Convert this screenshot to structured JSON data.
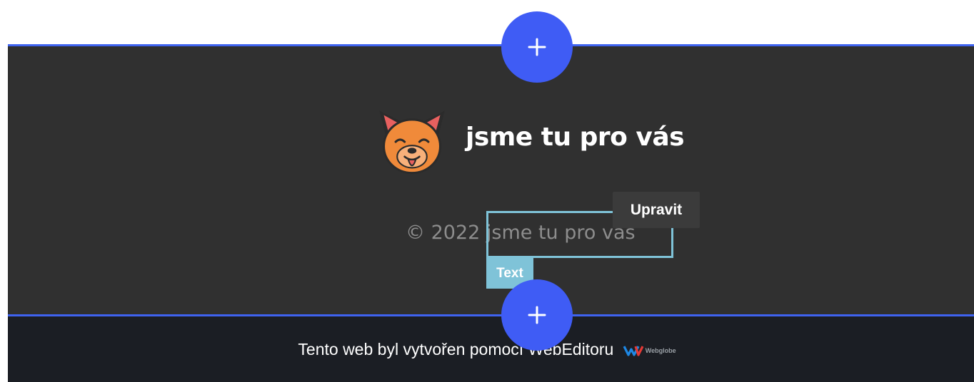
{
  "brand": {
    "title": "jsme tu pro vás",
    "logo_icon": "dog-face-icon"
  },
  "footer": {
    "copyright_year": "© 2022",
    "copyright_name": "jsme tu pro vás"
  },
  "editor": {
    "element_type_label": "Text",
    "edit_tooltip": "Upravit",
    "add_section_icon": "plus-icon"
  },
  "bottom_bar": {
    "text": "Tento web byl vytvořen pomocí WebEditoru",
    "logo_text": "Webglobe"
  },
  "colors": {
    "accent": "#3f5cf5",
    "section_bg": "#303030",
    "bottom_bg": "#1b1e24",
    "selection": "#7fc3d8"
  }
}
